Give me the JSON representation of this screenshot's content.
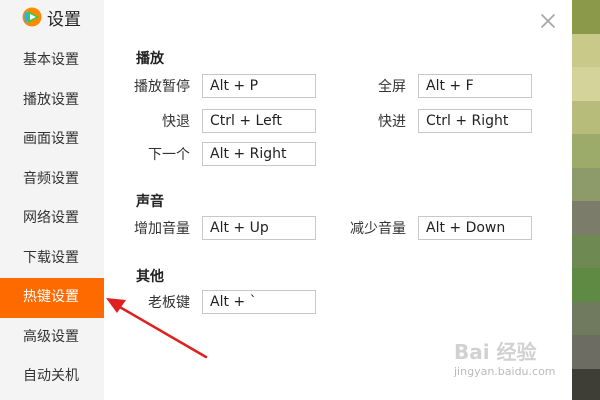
{
  "app": {
    "title": "设置",
    "logo_icon": "tencent-video-logo-icon"
  },
  "sidebar": {
    "items": [
      {
        "label": "基本设置",
        "active": false
      },
      {
        "label": "播放设置",
        "active": false
      },
      {
        "label": "画面设置",
        "active": false
      },
      {
        "label": "音频设置",
        "active": false
      },
      {
        "label": "网络设置",
        "active": false
      },
      {
        "label": "下载设置",
        "active": false
      },
      {
        "label": "热键设置",
        "active": true
      },
      {
        "label": "高级设置",
        "active": false
      },
      {
        "label": "自动关机",
        "active": false
      }
    ],
    "active_color": "#ff6a00"
  },
  "sections": {
    "playback": {
      "title": "播放",
      "pause_label": "播放暂停",
      "pause_value": "Alt + P",
      "fullscreen_label": "全屏",
      "fullscreen_value": "Alt + F",
      "rewind_label": "快退",
      "rewind_value": "Ctrl + Left",
      "forward_label": "快进",
      "forward_value": "Ctrl + Right",
      "next_label": "下一个",
      "next_value": "Alt + Right"
    },
    "sound": {
      "title": "声音",
      "volume_up_label": "增加音量",
      "volume_up_value": "Alt + Up",
      "volume_down_label": "减少音量",
      "volume_down_value": "Alt + Down"
    },
    "other": {
      "title": "其他",
      "boss_key_label": "老板键",
      "boss_key_value": "Alt + `"
    }
  },
  "watermark": {
    "brand": "Bai 经验",
    "url": "jingyan.baidu.com"
  },
  "colors": {
    "strip": [
      "#8a9a4a",
      "#c9c98a",
      "#d4d49a",
      "#b7bc7a",
      "#9caa6a",
      "#8d9a6a",
      "#7c7c6a",
      "#6e8a52",
      "#5f8a44",
      "#707a5e",
      "#6c6c62",
      "#3e3e36"
    ]
  }
}
